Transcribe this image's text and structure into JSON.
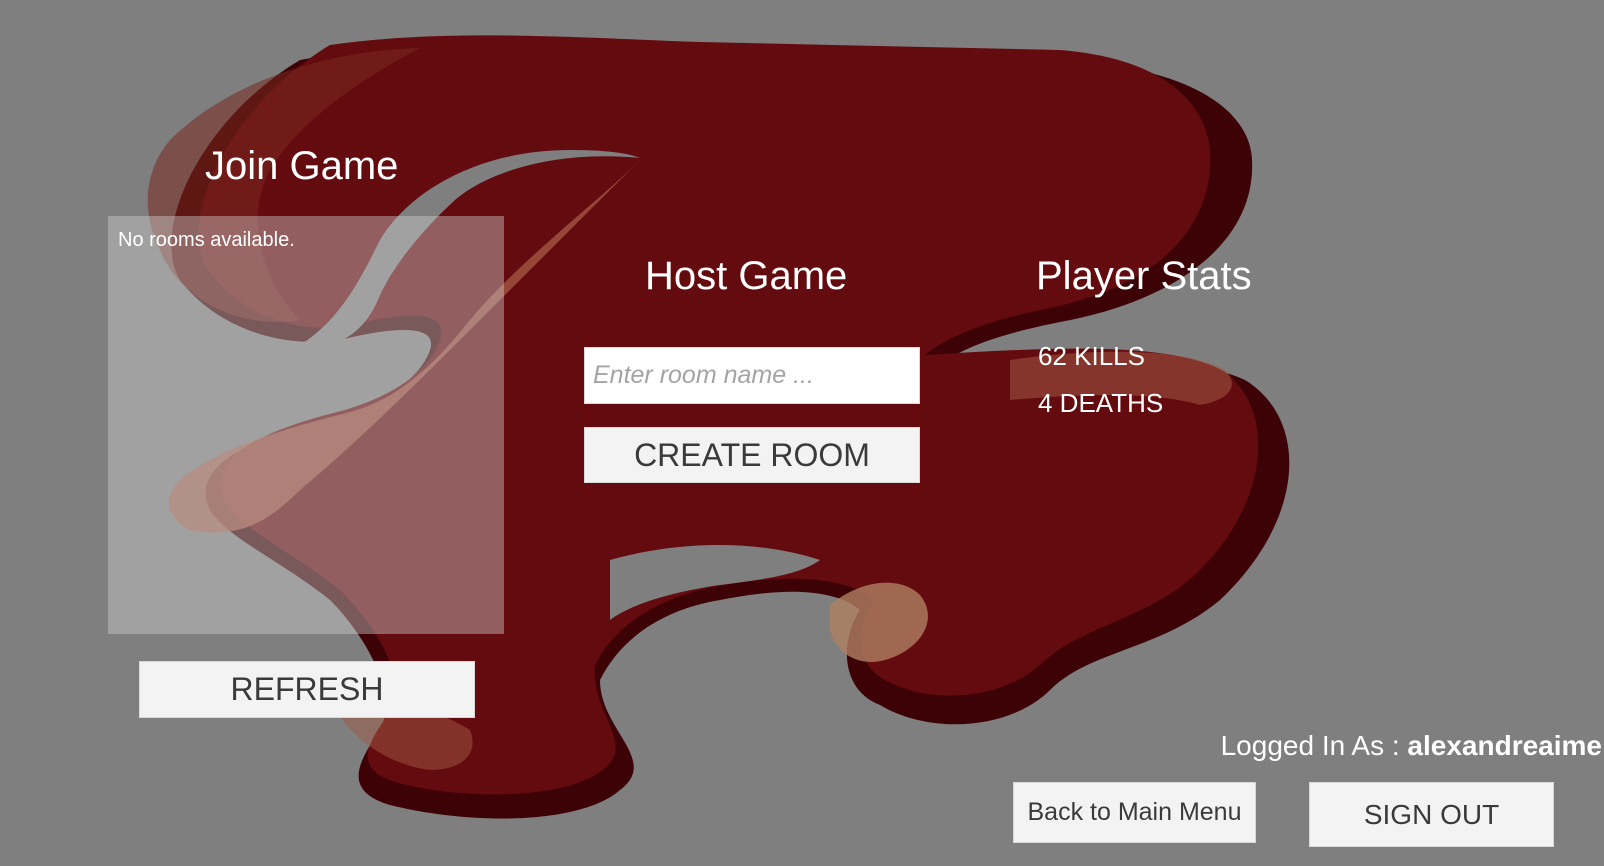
{
  "join": {
    "title": "Join Game",
    "empty_text": "No rooms available.",
    "refresh_label": "REFRESH"
  },
  "host": {
    "title": "Host Game",
    "input_placeholder": "Enter room name ...",
    "input_value": "",
    "create_label": "CREATE ROOM"
  },
  "stats": {
    "title": "Player Stats",
    "kills": "62 KILLS",
    "deaths": "4 DEATHS"
  },
  "account": {
    "logged_in_prefix": "Logged In As : ",
    "username": "alexandreaime",
    "back_label": "Back to Main Menu",
    "signout_label": "SIGN OUT"
  },
  "theme": {
    "background": "#7f7f7f",
    "logo_main": "#640b0f",
    "logo_shadow": "#3c0205",
    "logo_accent": "#a04a36"
  }
}
